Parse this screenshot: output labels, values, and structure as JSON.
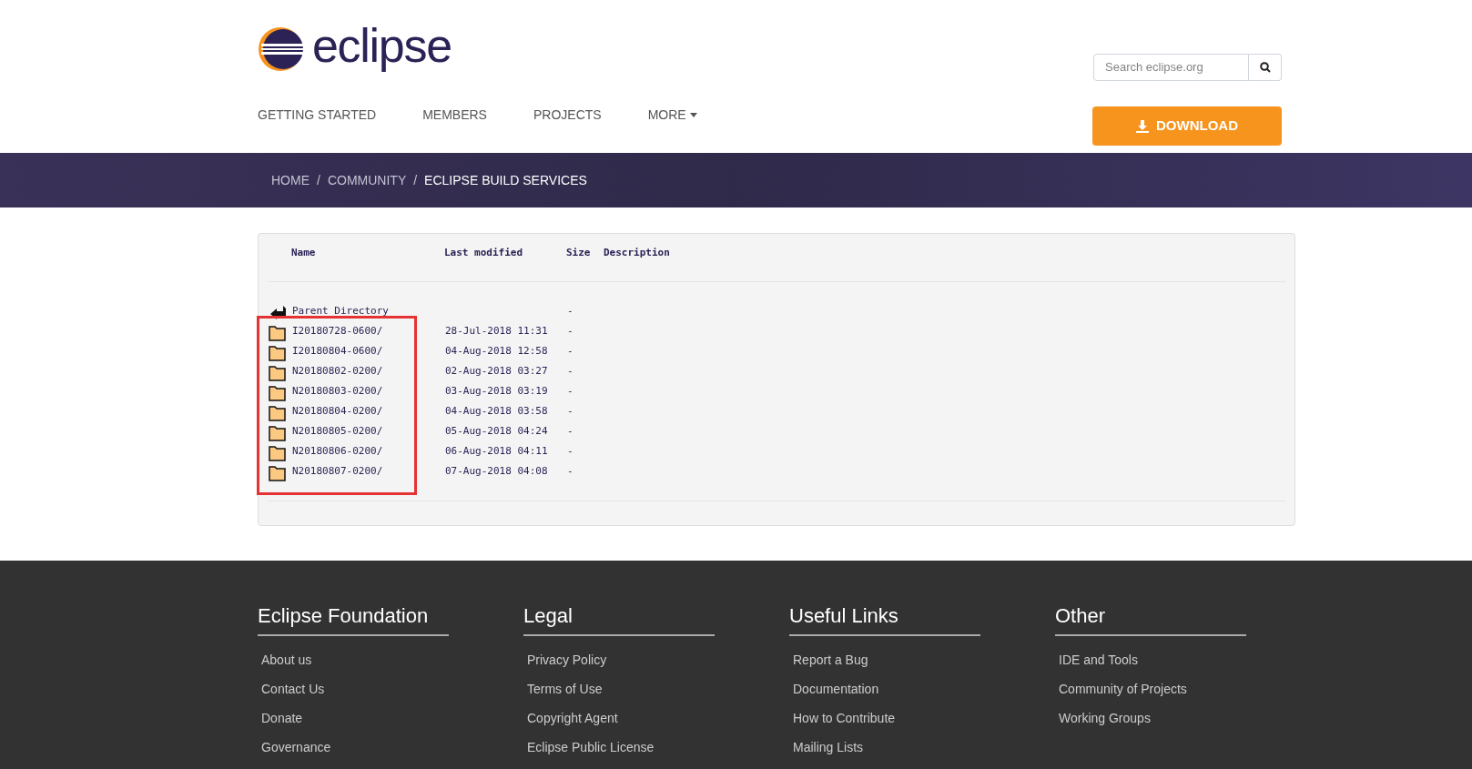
{
  "header": {
    "logo_text": "eclipse",
    "search": {
      "placeholder": "Search eclipse.org"
    },
    "nav": [
      {
        "label": "GETTING STARTED",
        "dropdown": false
      },
      {
        "label": "MEMBERS",
        "dropdown": false
      },
      {
        "label": "PROJECTS",
        "dropdown": false
      },
      {
        "label": "MORE",
        "dropdown": true
      }
    ],
    "download_button": "DOWNLOAD"
  },
  "breadcrumb": [
    {
      "label": "HOME",
      "separator": "/",
      "current": false
    },
    {
      "label": "COMMUNITY",
      "separator": "/",
      "current": false
    },
    {
      "label": "ECLIPSE BUILD SERVICES",
      "current": true
    }
  ],
  "listing": {
    "columns": [
      "Name",
      "Last modified",
      "Size",
      "Description"
    ],
    "rows": [
      {
        "kind": "parent",
        "name": "Parent Directory",
        "modified": "",
        "size": "-"
      },
      {
        "kind": "folder",
        "name": "I20180728-0600/",
        "modified": "28-Jul-2018 11:31",
        "size": "-"
      },
      {
        "kind": "folder",
        "name": "I20180804-0600/",
        "modified": "04-Aug-2018 12:58",
        "size": "-"
      },
      {
        "kind": "folder",
        "name": "N20180802-0200/",
        "modified": "02-Aug-2018 03:27",
        "size": "-"
      },
      {
        "kind": "folder",
        "name": "N20180803-0200/",
        "modified": "03-Aug-2018 03:19",
        "size": "-"
      },
      {
        "kind": "folder",
        "name": "N20180804-0200/",
        "modified": "04-Aug-2018 03:58",
        "size": "-"
      },
      {
        "kind": "folder",
        "name": "N20180805-0200/",
        "modified": "05-Aug-2018 04:24",
        "size": "-"
      },
      {
        "kind": "folder",
        "name": "N20180806-0200/",
        "modified": "06-Aug-2018 04:11",
        "size": "-"
      },
      {
        "kind": "folder",
        "name": "N20180807-0200/",
        "modified": "07-Aug-2018 04:08",
        "size": "-"
      }
    ]
  },
  "footer": [
    {
      "title": "Eclipse Foundation",
      "links": [
        "About us",
        "Contact Us",
        "Donate",
        "Governance"
      ]
    },
    {
      "title": "Legal",
      "links": [
        "Privacy Policy",
        "Terms of Use",
        "Copyright Agent",
        "Eclipse Public License"
      ]
    },
    {
      "title": "Useful Links",
      "links": [
        "Report a Bug",
        "Documentation",
        "How to Contribute",
        "Mailing Lists"
      ]
    },
    {
      "title": "Other",
      "links": [
        "IDE and Tools",
        "Community of Projects",
        "Working Groups"
      ]
    }
  ]
}
